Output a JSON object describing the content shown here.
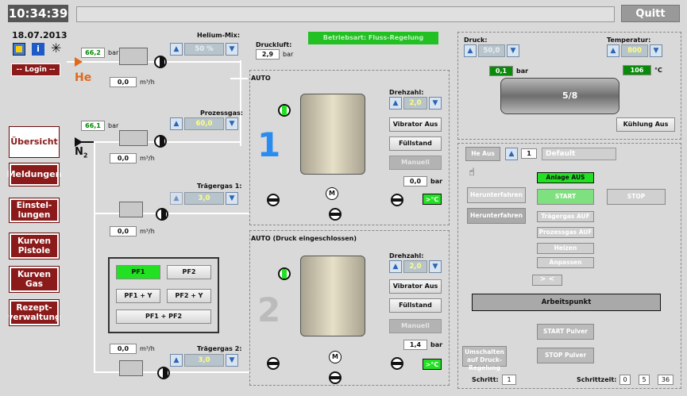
{
  "header": {
    "time": "10:34:39",
    "date": "18.07.2013",
    "quit": "Quitt"
  },
  "nav": {
    "login": "-- Login --",
    "overview": "Übersicht",
    "messages": "Meldungen",
    "settings": "Einstel-\nlungen",
    "curves_gun": "Kurven\nPistole",
    "curves_gas": "Kurven\nGas",
    "recipes": "Rezept-\nverwaltung"
  },
  "gas": {
    "he_value": "66,2",
    "n2_value": "66,1",
    "unit_bar": "bar",
    "unit_flow": "m³/h",
    "he_label": "He",
    "n2_label": "N",
    "n2_sub": "2",
    "he_flow": "0,0",
    "proc_flow": "0,0",
    "carrier1_flow": "0,0",
    "carrier2_flow": "0,0"
  },
  "helium_mix": {
    "label": "Helium-Mix:",
    "value": "50 %"
  },
  "process_gas": {
    "label": "Prozessgas:",
    "value": "60,0"
  },
  "carrier1": {
    "label": "Trägergas 1:",
    "value": "3,0"
  },
  "carrier2": {
    "label": "Trägergas 2:",
    "value": "3,0"
  },
  "pressure_air": {
    "label": "Druckluft:",
    "value": "2,9",
    "unit": "bar"
  },
  "mode_banner": "Betriebsart: Fluss-Regelung",
  "feeder1": {
    "title": "AUTO",
    "number": "1",
    "speed_label": "Drehzahl:",
    "speed_value": "2,0",
    "vibrator": "Vibrator Aus",
    "fill": "Füllstand",
    "manual": "Manuell",
    "pressure": "0,0",
    "unit": "bar",
    "temp": ">°C",
    "motor": "M"
  },
  "feeder2": {
    "title": "AUTO (Druck eingeschlossen)",
    "number": "2",
    "speed_label": "Drehzahl:",
    "speed_value": "2,0",
    "vibrator": "Vibrator Aus",
    "fill": "Füllstand",
    "manual": "Manuell",
    "pressure": "1,4",
    "unit": "bar",
    "temp": ">°C",
    "motor": "M"
  },
  "pf": {
    "pf1": "PF1",
    "pf2": "PF2",
    "pf1y": "PF1 + Y",
    "pf2y": "PF2 + Y",
    "pf1pf2": "PF1 + PF2"
  },
  "gun": {
    "pressure_label": "Druck:",
    "pressure_value": "50,0",
    "temp_label": "Temperatur:",
    "temp_value": "800",
    "actual_pressure": "0,1",
    "actual_temp": "106",
    "unit_bar": "bar",
    "unit_temp": "°C",
    "nozzle": "5/8",
    "cooling": "Kühlung Aus"
  },
  "sequence": {
    "he_off": "He Aus",
    "number": "1",
    "recipe": "Default",
    "anlage": "Anlage AUS",
    "shutdown1": "Herunterfahren",
    "start": "START",
    "stop": "STOP",
    "shutdown2": "Herunterfahren",
    "carrier_on": "Trägergas AUF",
    "process_on": "Prozessgas AUF",
    "heat": "Heizen",
    "adjust": "Anpassen",
    "lt": "> <",
    "workpoint": "Arbeitspunkt",
    "start_powder": "START Pulver",
    "stop_powder": "STOP Pulver",
    "switch": "Umschalten auf Druck-Regelung",
    "step_label": "Schritt:",
    "step_value": "1",
    "steptime_label": "Schrittzeit:",
    "t_h": "0",
    "t_m": "5",
    "t_s": "36"
  },
  "colors": {
    "nav_red": "#8b1a1a",
    "green": "#22e022",
    "panel_gray": "#d9d9d9",
    "blue_number": "#2a8cf0"
  }
}
